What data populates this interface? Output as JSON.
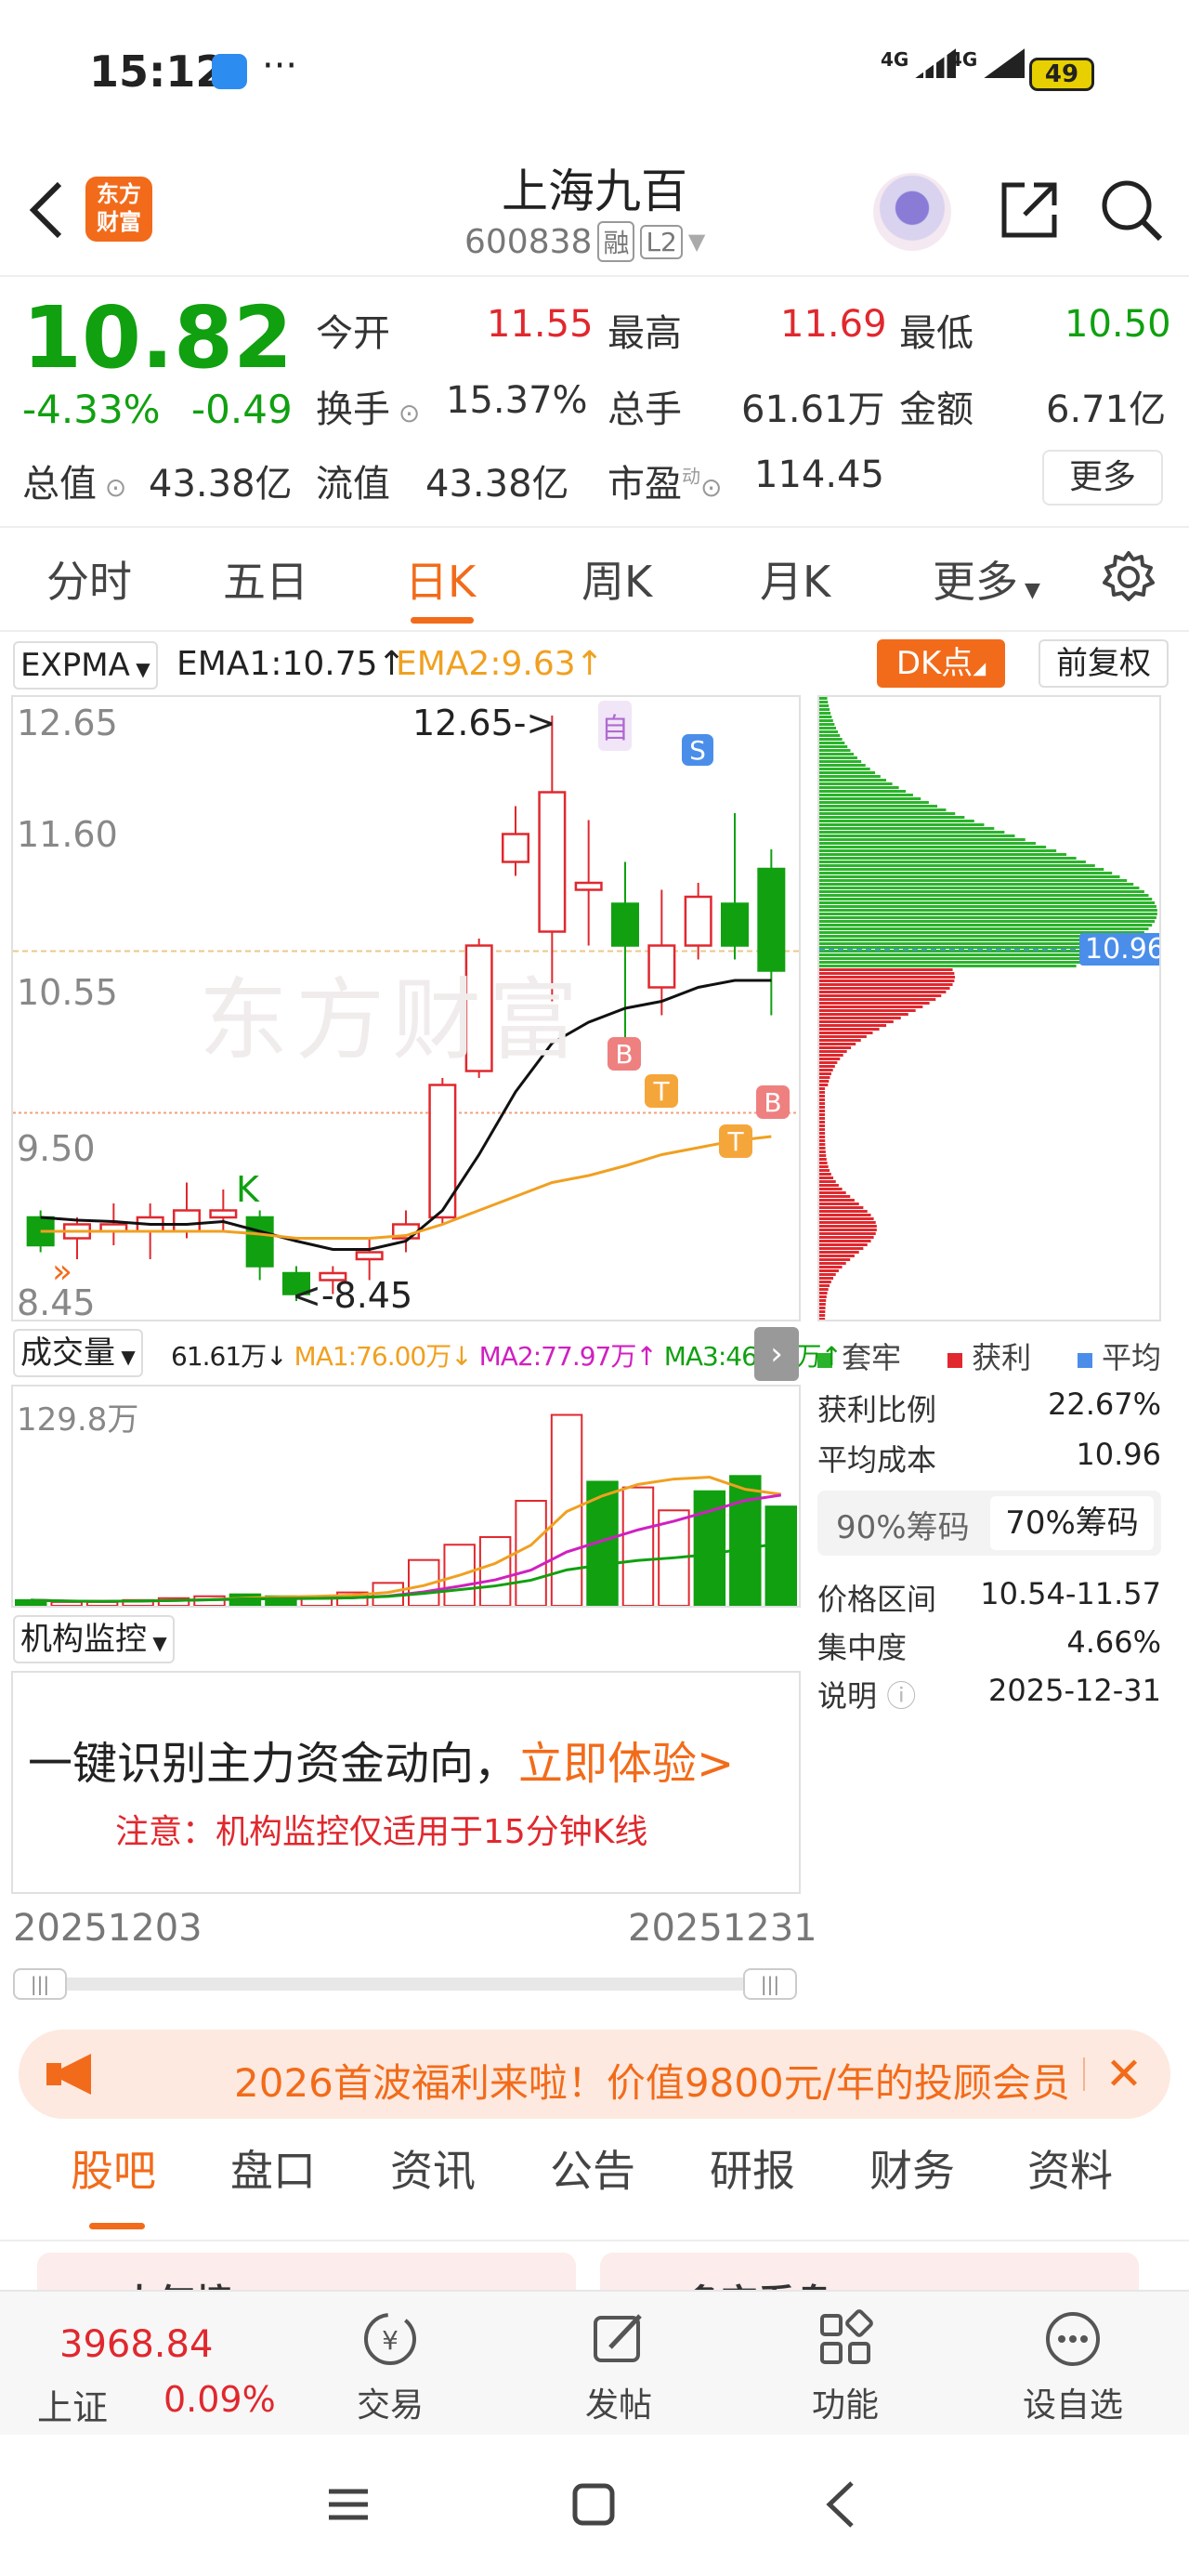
{
  "status": {
    "time": "15:12",
    "dots": "···",
    "sig1": "4G",
    "sig2": "4G",
    "battery": "49"
  },
  "header": {
    "title": "上海九百",
    "code": "600838",
    "badge1": "融",
    "badge2": "L2",
    "logo_line1": "东方",
    "logo_line2": "财富"
  },
  "quote": {
    "price": "10.82",
    "change_pct": "-4.33%",
    "change_val": "-0.49",
    "open_label": "今开",
    "open": "11.55",
    "high_label": "最高",
    "high": "11.69",
    "low_label": "最低",
    "low": "10.50",
    "turnover_label": "换手",
    "turnover": "15.37%",
    "vol_label": "总手",
    "vol": "61.61万",
    "amount_label": "金额",
    "amount": "6.71亿",
    "mktcap_label": "总值",
    "mktcap": "43.38亿",
    "float_label": "流值",
    "float": "43.38亿",
    "pe_label": "市盈",
    "pe_sup": "动",
    "pe": "114.45",
    "more_btn": "更多"
  },
  "chart_tabs": [
    "分时",
    "五日",
    "日K",
    "周K",
    "月K",
    "更多"
  ],
  "indicator": {
    "name": "EXPMA",
    "ema1": "EMA1:10.75",
    "ema1_arrow": "↑",
    "ema2": "EMA2:9.63",
    "ema2_arrow": "↑",
    "dk_btn": "DK点",
    "fq_btn": "前复权"
  },
  "kline": {
    "y_labels": [
      "12.65",
      "11.60",
      "10.55",
      "9.50",
      "8.45"
    ],
    "max_label": "12.65->",
    "min_label": "<-8.45",
    "watermark": "东方财富",
    "mark_zi": "自",
    "mark_s": "S",
    "mark_k": "K",
    "mark_b": "B",
    "mark_t": "T"
  },
  "chip": {
    "avg_label": "10.96",
    "legend": [
      "套牢",
      "获利",
      "平均"
    ],
    "rows": [
      {
        "k": "获利比例",
        "v": "22.67%"
      },
      {
        "k": "平均成本",
        "v": "10.96"
      }
    ],
    "tab90": "90%筹码",
    "tab70": "70%筹码",
    "rows2": [
      {
        "k": "价格区间",
        "v": "10.54-11.57"
      },
      {
        "k": "集中度",
        "v": "4.66%"
      },
      {
        "k": "说明",
        "v": "2025-12-31"
      }
    ]
  },
  "volume": {
    "name": "成交量",
    "vol": "61.61万↓",
    "ma1": "MA1:76.00万↓",
    "ma2": "MA2:77.97万↑",
    "ma3": "MA3:46.82万↑",
    "max_label": "129.8万"
  },
  "inst": {
    "name": "机构监控",
    "main": "一键识别主力资金动向，",
    "cta": "立即体验>",
    "note": "注意：机构监控仅适用于15分钟K线"
  },
  "range": {
    "start": "20251203",
    "end": "20251231"
  },
  "banner": {
    "text": "2026首波福利来啦！价值9800元/年的投顾会员"
  },
  "bottom_tabs": [
    "股吧",
    "盘口",
    "资讯",
    "公告",
    "研报",
    "财务",
    "资料"
  ],
  "partial": {
    "a": "大气榜",
    "b": "多空看盘"
  },
  "nav": {
    "index_val": "3968.84",
    "index_name": "上证",
    "index_pct": "0.09%",
    "items": [
      "交易",
      "发帖",
      "功能",
      "设自选"
    ]
  },
  "colors": {
    "up": "#e0282e",
    "down": "#10a010",
    "accent": "#f26b1a"
  },
  "chart_data": {
    "type": "candlestick",
    "dates_range": [
      "20251203",
      "20251231"
    ],
    "candles": [
      {
        "o": 9.05,
        "c": 8.85,
        "h": 9.1,
        "l": 8.8
      },
      {
        "o": 8.9,
        "c": 9.0,
        "h": 9.05,
        "l": 8.75
      },
      {
        "o": 8.95,
        "c": 9.0,
        "h": 9.15,
        "l": 8.85
      },
      {
        "o": 8.95,
        "c": 9.05,
        "h": 9.15,
        "l": 8.75
      },
      {
        "o": 8.95,
        "c": 9.1,
        "h": 9.3,
        "l": 8.9
      },
      {
        "o": 9.05,
        "c": 9.1,
        "h": 9.25,
        "l": 8.95
      },
      {
        "o": 9.05,
        "c": 8.7,
        "h": 9.1,
        "l": 8.6
      },
      {
        "o": 8.65,
        "c": 8.5,
        "h": 8.7,
        "l": 8.45
      },
      {
        "o": 8.6,
        "c": 8.65,
        "h": 8.7,
        "l": 8.5
      },
      {
        "o": 8.75,
        "c": 8.8,
        "h": 8.9,
        "l": 8.6
      },
      {
        "o": 8.9,
        "c": 9.0,
        "h": 9.1,
        "l": 8.8
      },
      {
        "o": 9.05,
        "c": 10.0,
        "h": 10.05,
        "l": 9.0
      },
      {
        "o": 10.1,
        "c": 11.0,
        "h": 11.05,
        "l": 10.05
      },
      {
        "o": 11.6,
        "c": 11.8,
        "h": 12.0,
        "l": 11.5
      },
      {
        "o": 11.1,
        "c": 12.1,
        "h": 12.65,
        "l": 10.6
      },
      {
        "o": 11.4,
        "c": 11.45,
        "h": 11.9,
        "l": 11.0
      },
      {
        "o": 11.3,
        "c": 11.0,
        "h": 11.6,
        "l": 10.3
      },
      {
        "o": 10.7,
        "c": 11.0,
        "h": 11.4,
        "l": 10.5
      },
      {
        "o": 11.0,
        "c": 11.35,
        "h": 11.45,
        "l": 10.9
      },
      {
        "o": 11.3,
        "c": 11.0,
        "h": 11.95,
        "l": 10.9
      },
      {
        "o": 11.55,
        "c": 10.82,
        "h": 11.69,
        "l": 10.5
      }
    ],
    "ema1": [
      9.05,
      9.03,
      9.02,
      9.0,
      9.0,
      9.02,
      8.95,
      8.88,
      8.82,
      8.82,
      8.88,
      9.1,
      9.5,
      9.95,
      10.3,
      10.45,
      10.55,
      10.6,
      10.7,
      10.75,
      10.75
    ],
    "ema2": [
      8.95,
      8.95,
      8.95,
      8.95,
      8.95,
      8.95,
      8.93,
      8.9,
      8.9,
      8.9,
      8.92,
      9.0,
      9.1,
      9.2,
      9.3,
      9.35,
      9.42,
      9.5,
      9.55,
      9.6,
      9.63
    ],
    "volume": [
      3,
      2,
      2,
      3,
      4,
      5,
      6,
      5,
      5,
      7,
      12,
      24,
      32,
      36,
      55,
      100,
      65,
      62,
      50,
      60,
      68,
      52
    ]
  }
}
